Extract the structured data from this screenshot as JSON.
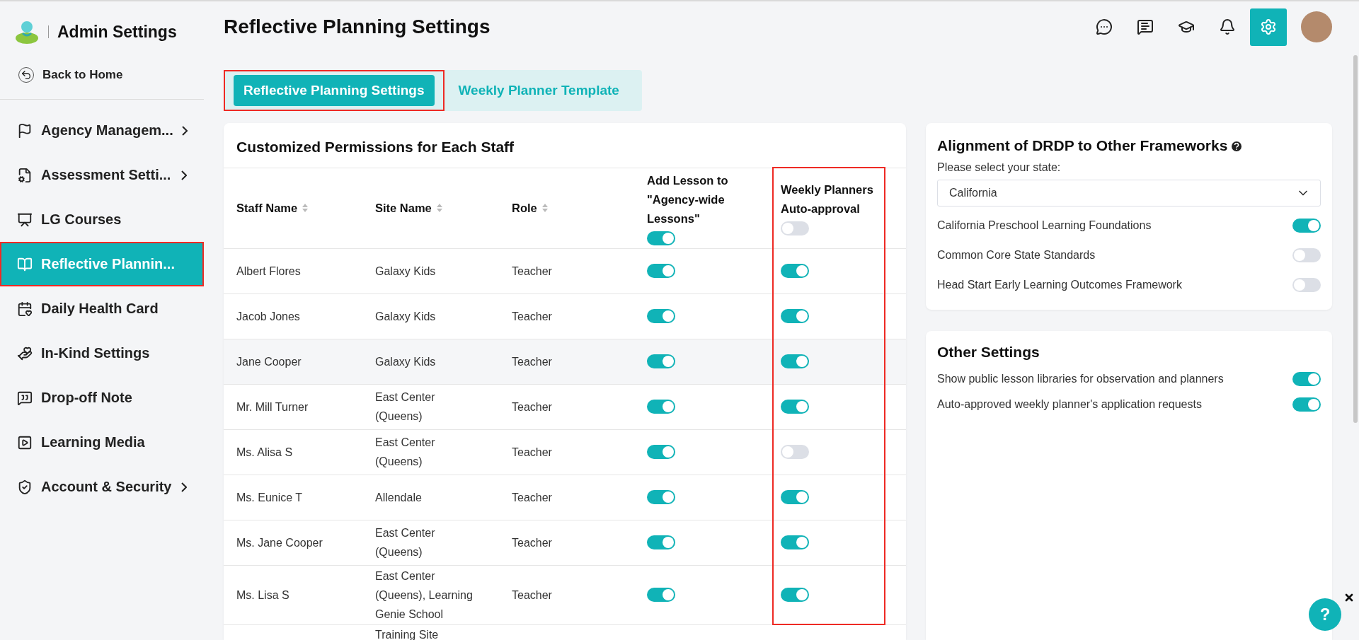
{
  "sidebar": {
    "title": "Admin Settings",
    "back": "Back to Home",
    "items": [
      {
        "label": "Agency Managem...",
        "has_children": true,
        "selected": false,
        "outlined": false
      },
      {
        "label": "Assessment Setti...",
        "has_children": true,
        "selected": false,
        "outlined": false
      },
      {
        "label": "LG Courses",
        "has_children": false,
        "selected": false,
        "outlined": false
      },
      {
        "label": "Reflective Plannin...",
        "has_children": false,
        "selected": true,
        "outlined": true
      },
      {
        "label": "Daily Health Card",
        "has_children": false,
        "selected": false,
        "outlined": false
      },
      {
        "label": "In-Kind Settings",
        "has_children": false,
        "selected": false,
        "outlined": false
      },
      {
        "label": "Drop-off Note",
        "has_children": false,
        "selected": false,
        "outlined": false
      },
      {
        "label": "Learning Media",
        "has_children": false,
        "selected": false,
        "outlined": false
      },
      {
        "label": "Account & Security",
        "has_children": true,
        "selected": false,
        "outlined": false
      }
    ]
  },
  "page_title": "Reflective Planning Settings",
  "header_icons": [
    {
      "selected": false
    },
    {
      "selected": false
    },
    {
      "selected": false
    },
    {
      "selected": false
    },
    {
      "selected": true
    }
  ],
  "tabs": [
    {
      "label": "Reflective Planning Settings",
      "selected": true,
      "outlined": true
    },
    {
      "label": "Weekly Planner Template",
      "selected": false,
      "outlined": false
    }
  ],
  "permissions": {
    "title": "Customized Permissions for Each Staff",
    "columns": [
      {
        "label": "Staff Name",
        "sortable": true,
        "outlined": false
      },
      {
        "label": "Site Name",
        "sortable": true,
        "outlined": false
      },
      {
        "label": "Role",
        "sortable": true,
        "outlined": false
      },
      {
        "label": "Add Lesson to \"Agency-wide Lessons\"",
        "outlined": false,
        "on": true
      },
      {
        "label": "Weekly Planners Auto-approval",
        "outlined": true,
        "on": false
      }
    ],
    "rows": [
      {
        "staff": "Albert Flores",
        "site": "Galaxy Kids",
        "role": "Teacher",
        "add_lesson": true,
        "auto_approval": true,
        "hovered": false
      },
      {
        "staff": "Jacob Jones",
        "site": "Galaxy Kids",
        "role": "Teacher",
        "add_lesson": true,
        "auto_approval": true,
        "hovered": false
      },
      {
        "staff": "Jane Cooper",
        "site": "Galaxy Kids",
        "role": "Teacher",
        "add_lesson": true,
        "auto_approval": true,
        "hovered": true
      },
      {
        "staff": "Mr. Mill Turner",
        "site": "East Center (Queens)",
        "role": "Teacher",
        "add_lesson": true,
        "auto_approval": true,
        "hovered": false
      },
      {
        "staff": "Ms. Alisa S",
        "site": "East Center (Queens)",
        "role": "Teacher",
        "add_lesson": true,
        "auto_approval": false,
        "hovered": false
      },
      {
        "staff": "Ms. Eunice T",
        "site": "Allendale",
        "role": "Teacher",
        "add_lesson": true,
        "auto_approval": true,
        "hovered": false
      },
      {
        "staff": "Ms. Jane Cooper",
        "site": "East Center (Queens)",
        "role": "Teacher",
        "add_lesson": true,
        "auto_approval": true,
        "hovered": false
      },
      {
        "staff": "Ms. Lisa S",
        "site": "East Center (Queens), Learning Genie School",
        "role": "Teacher",
        "add_lesson": true,
        "auto_approval": true,
        "hovered": false
      },
      {
        "site": "Training Site",
        "hovered": false
      }
    ]
  },
  "alignment": {
    "title": "Alignment of DRDP to Other Frameworks",
    "label": "Please select your state:",
    "state": "California",
    "frameworks": [
      {
        "label": "California Preschool Learning Foundations",
        "on": true
      },
      {
        "label": "Common Core State Standards",
        "on": false
      },
      {
        "label": "Head Start Early Learning Outcomes Framework",
        "on": false
      }
    ]
  },
  "other_settings": {
    "title": "Other Settings",
    "items": [
      {
        "label": "Show public lesson libraries for observation and planners",
        "on": true
      },
      {
        "label": "Auto-approved weekly planner's application requests",
        "on": true
      }
    ]
  },
  "help": {
    "label": "?"
  }
}
